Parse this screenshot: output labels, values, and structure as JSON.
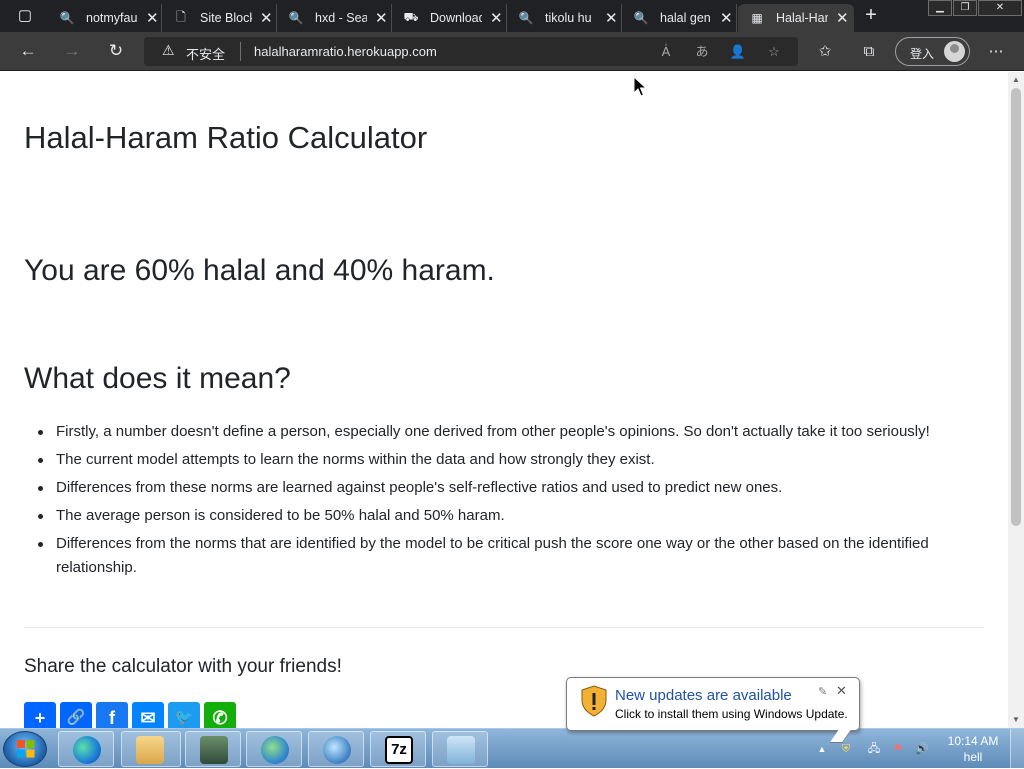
{
  "browser": {
    "tabs": [
      {
        "icon": "search-icon",
        "title": "notmyfau"
      },
      {
        "icon": "page-icon",
        "title": "Site Block"
      },
      {
        "icon": "search-icon",
        "title": "hxd - Sea"
      },
      {
        "icon": "download-site-icon",
        "title": "Download"
      },
      {
        "icon": "search-icon",
        "title": "tikolu hu"
      },
      {
        "icon": "search-icon",
        "title": "halal gen"
      },
      {
        "icon": "calculator-icon",
        "title": "Halal-Har"
      }
    ],
    "insecure_label": "不安全",
    "url": "halalharamratio.herokuapp.com",
    "signin_label": "登入"
  },
  "page": {
    "title": "Halal-Haram Ratio Calculator",
    "result": "You are 60% halal and 40% haram.",
    "meaning_heading": "What does it mean?",
    "points": [
      "Firstly, a number doesn't define a person, especially one derived from other people's opinions. So don't actually take it too seriously!",
      "The current model attempts to learn the norms within the data and how strongly they exist.",
      "Differences from these norms are learned against people's self-reflective ratios and used to predict new ones.",
      "The average person is considered to be 50% halal and 50% haram.",
      "Differences from the norms that are identified by the model to be critical push the score one way or the other based on the identified relationship."
    ],
    "share_text": "Share the calculator with your friends!",
    "share_buttons": [
      {
        "name": "share-addtoany",
        "glyph": "+",
        "color": "#0166ff"
      },
      {
        "name": "share-copy-link",
        "glyph": "🔗",
        "color": "#0166ff"
      },
      {
        "name": "share-facebook",
        "glyph": "f",
        "color": "#1877f2"
      },
      {
        "name": "share-messenger",
        "glyph": "✉",
        "color": "#0084ff"
      },
      {
        "name": "share-twitter",
        "glyph": "🐦",
        "color": "#1d9bf0"
      },
      {
        "name": "share-whatsapp",
        "glyph": "✆",
        "color": "#12af0a"
      }
    ]
  },
  "notification": {
    "title": "New updates are available",
    "text": "Click to install them using Windows Update."
  },
  "taskbar": {
    "apps": [
      "edge-app",
      "file-explorer-app",
      "monitor-app",
      "network-app",
      "internet-app",
      "7zip-app",
      "notepad-app"
    ],
    "time": "10:14 AM",
    "user": "hell"
  }
}
